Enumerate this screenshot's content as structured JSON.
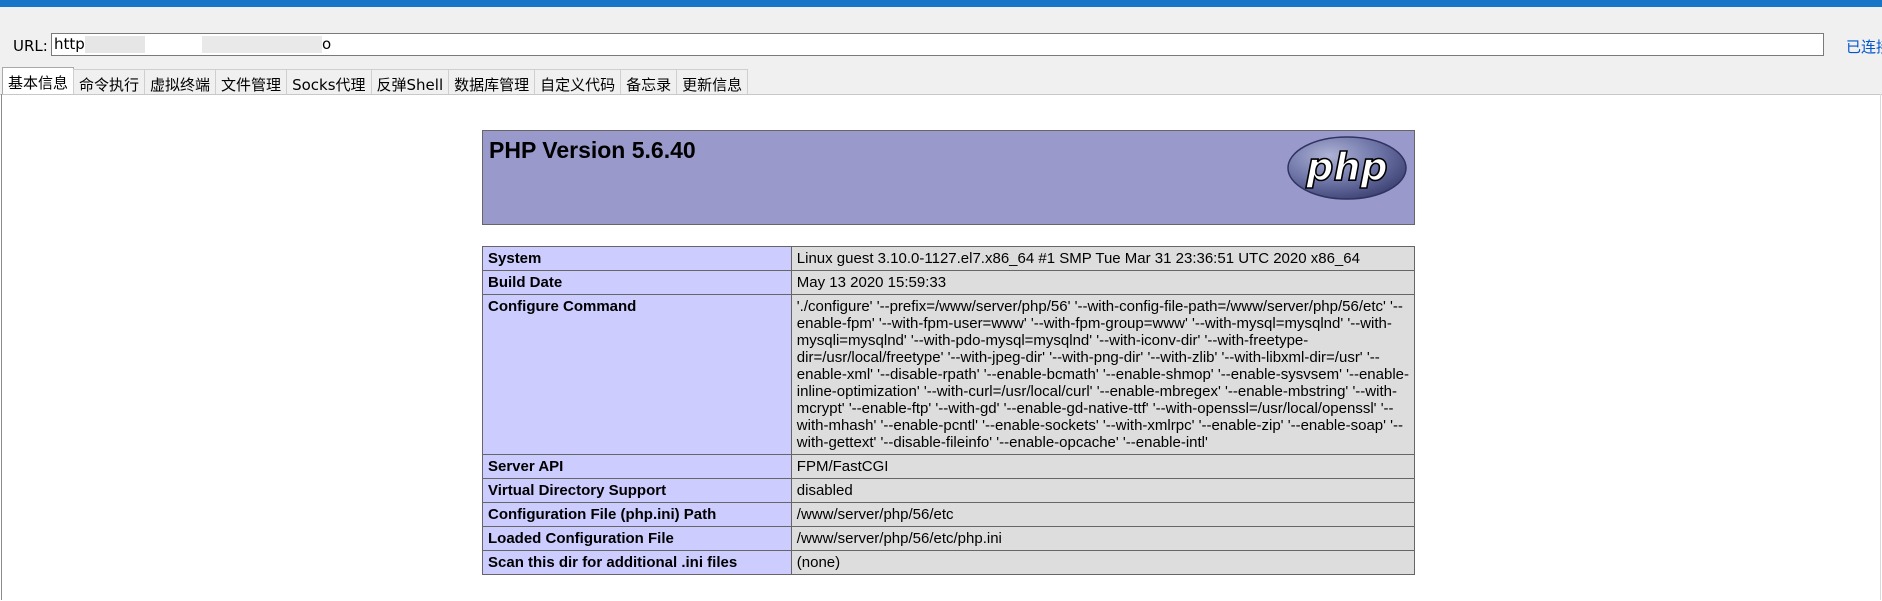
{
  "window": {
    "title_fragment": "",
    "accent_color": "#1875c7"
  },
  "toolbar": {
    "url_label": "URL:",
    "url_value": "http",
    "url_suffix": "o",
    "status_text": "已连接"
  },
  "tabs": [
    {
      "label": "基本信息",
      "active": true
    },
    {
      "label": "命令执行",
      "active": false
    },
    {
      "label": "虚拟终端",
      "active": false
    },
    {
      "label": "文件管理",
      "active": false
    },
    {
      "label": "Socks代理",
      "active": false
    },
    {
      "label": "反弹Shell",
      "active": false
    },
    {
      "label": "数据库管理",
      "active": false
    },
    {
      "label": "自定义代码",
      "active": false
    },
    {
      "label": "备忘录",
      "active": false
    },
    {
      "label": "更新信息",
      "active": false
    }
  ],
  "phpinfo": {
    "title": "PHP Version 5.6.40",
    "logo_text": "php",
    "colors": {
      "header_bg": "#9999cc",
      "key_bg": "#ccccff",
      "value_bg": "#dddddd"
    },
    "rows": [
      {
        "key": "System",
        "value": "Linux guest 3.10.0-1127.el7.x86_64 #1 SMP Tue Mar 31 23:36:51 UTC 2020 x86_64"
      },
      {
        "key": "Build Date",
        "value": "May 13 2020 15:59:33"
      },
      {
        "key": "Configure Command",
        "value_lines": [
          "'./configure' '--prefix=/www/server/php/56' '--with-config-file-path=/www/server/php/56/etc' '--",
          "enable-fpm' '--with-fpm-user=www' '--with-fpm-group=www' '--with-mysql=mysqlnd' '--with-",
          "mysqli=mysqlnd' '--with-pdo-mysql=mysqlnd' '--with-iconv-dir' '--with-freetype-",
          "dir=/usr/local/freetype' '--with-jpeg-dir' '--with-png-dir' '--with-zlib' '--with-libxml-dir=/usr' '--",
          "enable-xml' '--disable-rpath' '--enable-bcmath' '--enable-shmop' '--enable-sysvsem' '--enable-",
          "inline-optimization' '--with-curl=/usr/local/curl' '--enable-mbregex' '--enable-mbstring' '--with-",
          "mcrypt' '--enable-ftp' '--with-gd' '--enable-gd-native-ttf' '--with-openssl=/usr/local/openssl' '--",
          "with-mhash' '--enable-pcntl' '--enable-sockets' '--with-xmlrpc' '--enable-zip' '--enable-soap' '--",
          "with-gettext' '--disable-fileinfo' '--enable-opcache' '--enable-intl'"
        ]
      },
      {
        "key": "Server API",
        "value": "FPM/FastCGI"
      },
      {
        "key": "Virtual Directory Support",
        "value": "disabled"
      },
      {
        "key": "Configuration File (php.ini) Path",
        "value": "/www/server/php/56/etc"
      },
      {
        "key": "Loaded Configuration File",
        "value": "/www/server/php/56/etc/php.ini"
      },
      {
        "key": "Scan this dir for additional .ini files",
        "value": "(none)"
      }
    ]
  }
}
